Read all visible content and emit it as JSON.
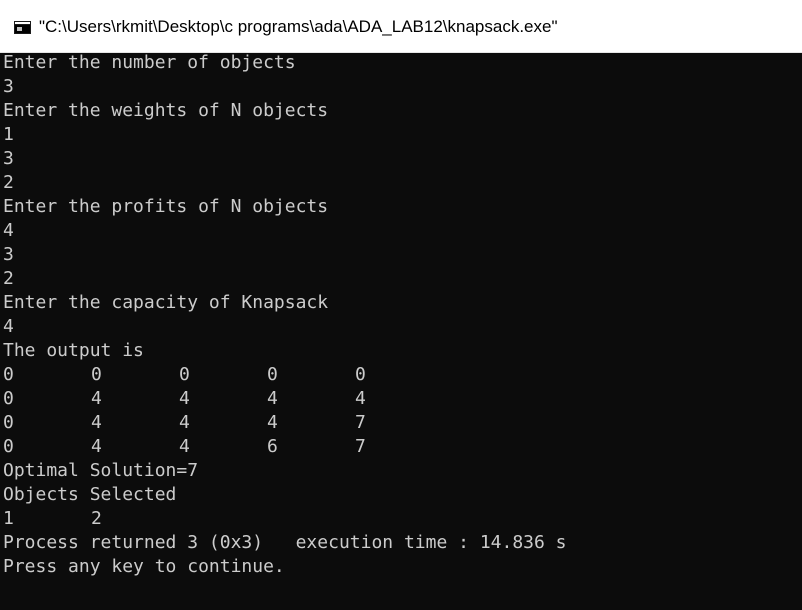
{
  "window": {
    "title": "\"C:\\Users\\rkmit\\Desktop\\c programs\\ada\\ADA_LAB12\\knapsack.exe\""
  },
  "console": {
    "prompt_num_objects": "Enter the number of objects",
    "num_objects": "3",
    "prompt_weights": "Enter the weights of N objects",
    "weights": [
      "1",
      "3",
      "2"
    ],
    "prompt_profits": "Enter the profits of N objects",
    "profits": [
      "4",
      "3",
      "2"
    ],
    "prompt_capacity": "Enter the capacity of Knapsack",
    "capacity": "4",
    "output_header": "The output is",
    "table": [
      [
        "0",
        "0",
        "0",
        "0",
        "0"
      ],
      [
        "0",
        "4",
        "4",
        "4",
        "4"
      ],
      [
        "0",
        "4",
        "4",
        "4",
        "7"
      ],
      [
        "0",
        "4",
        "4",
        "6",
        "7"
      ]
    ],
    "optimal_solution": "Optimal Solution=7",
    "objects_selected_label": "Objects Selected",
    "objects_selected": [
      "1",
      "2"
    ],
    "process_returned": "Process returned 3 (0x3)   execution time : 14.836 s",
    "press_any_key": "Press any key to continue."
  }
}
